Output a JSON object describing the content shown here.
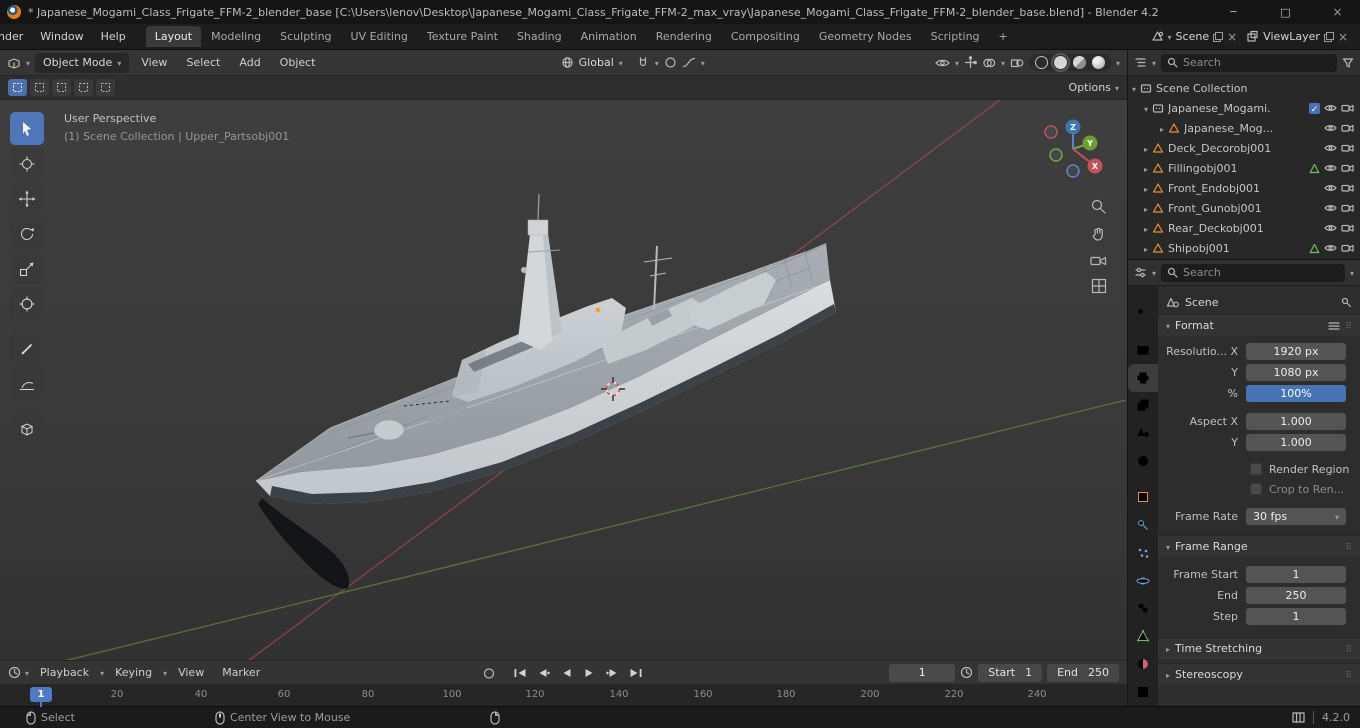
{
  "titlebar": {
    "title": "* Japanese_Mogami_Class_Frigate_FFM-2_blender_base [C:\\Users\\lenov\\Desktop\\Japanese_Mogami_Class_Frigate_FFM-2_max_vray\\Japanese_Mogami_Class_Frigate_FFM-2_blender_base.blend] - Blender 4.2"
  },
  "topbar": {
    "menus": [
      "nder",
      "Window",
      "Help"
    ],
    "workspaces": [
      "Layout",
      "Modeling",
      "Sculpting",
      "UV Editing",
      "Texture Paint",
      "Shading",
      "Animation",
      "Rendering",
      "Compositing",
      "Geometry Nodes",
      "Scripting"
    ],
    "add_tab": "+",
    "scene_label": "Scene",
    "viewlayer_label": "ViewLayer"
  },
  "vpheader": {
    "mode": "Object Mode",
    "menus": [
      "View",
      "Select",
      "Add",
      "Object"
    ],
    "orientation": "Global",
    "options": "Options"
  },
  "viewport": {
    "overlay_line1": "User Perspective",
    "overlay_line2": "(1) Scene Collection | Upper_Partsobj001",
    "gizmo": {
      "x": "X",
      "y": "Y",
      "z": "Z"
    }
  },
  "outliner": {
    "search_placeholder": "Search",
    "rows": [
      {
        "label": "Scene Collection"
      },
      {
        "label": "Japanese_Mogami."
      },
      {
        "label": "Japanese_Mog..."
      },
      {
        "label": "Deck_Decorobj001"
      },
      {
        "label": "Fillingobj001"
      },
      {
        "label": "Front_Endobj001"
      },
      {
        "label": "Front_Gunobj001"
      },
      {
        "label": "Rear_Deckobj001"
      },
      {
        "label": "Shipobj001"
      }
    ]
  },
  "properties": {
    "search_placeholder": "Search",
    "breadcrumb": "Scene",
    "format": {
      "title": "Format",
      "rows": [
        {
          "label": "Resolutio... X",
          "value": "1920 px"
        },
        {
          "label": "Y",
          "value": "1080 px"
        },
        {
          "label": "%",
          "value": "100%"
        },
        {
          "label": "Aspect X",
          "value": "1.000"
        },
        {
          "label": "Y",
          "value": "1.000"
        }
      ],
      "check1": "Render Region",
      "check2": "Crop to Ren...",
      "frame_rate_label": "Frame Rate",
      "frame_rate_value": "30 fps"
    },
    "frame_range": {
      "title": "Frame Range",
      "rows": [
        {
          "label": "Frame Start",
          "value": "1"
        },
        {
          "label": "End",
          "value": "250"
        },
        {
          "label": "Step",
          "value": "1"
        }
      ]
    },
    "time_stretching_title": "Time Stretching",
    "stereoscopy_title": "Stereoscopy"
  },
  "timeline": {
    "menus": [
      "Playback",
      "Keying",
      "View",
      "Marker"
    ],
    "current_frame": "1",
    "start_label": "Start",
    "start_value": "1",
    "end_label": "End",
    "end_value": "250",
    "playhead": "1",
    "ticks": [
      "20",
      "40",
      "60",
      "80",
      "100",
      "120",
      "140",
      "160",
      "180",
      "200",
      "220",
      "240"
    ]
  },
  "statusbar": {
    "select_label": "Select",
    "center_label": "Center View to Mouse",
    "version": "4.2.0"
  }
}
